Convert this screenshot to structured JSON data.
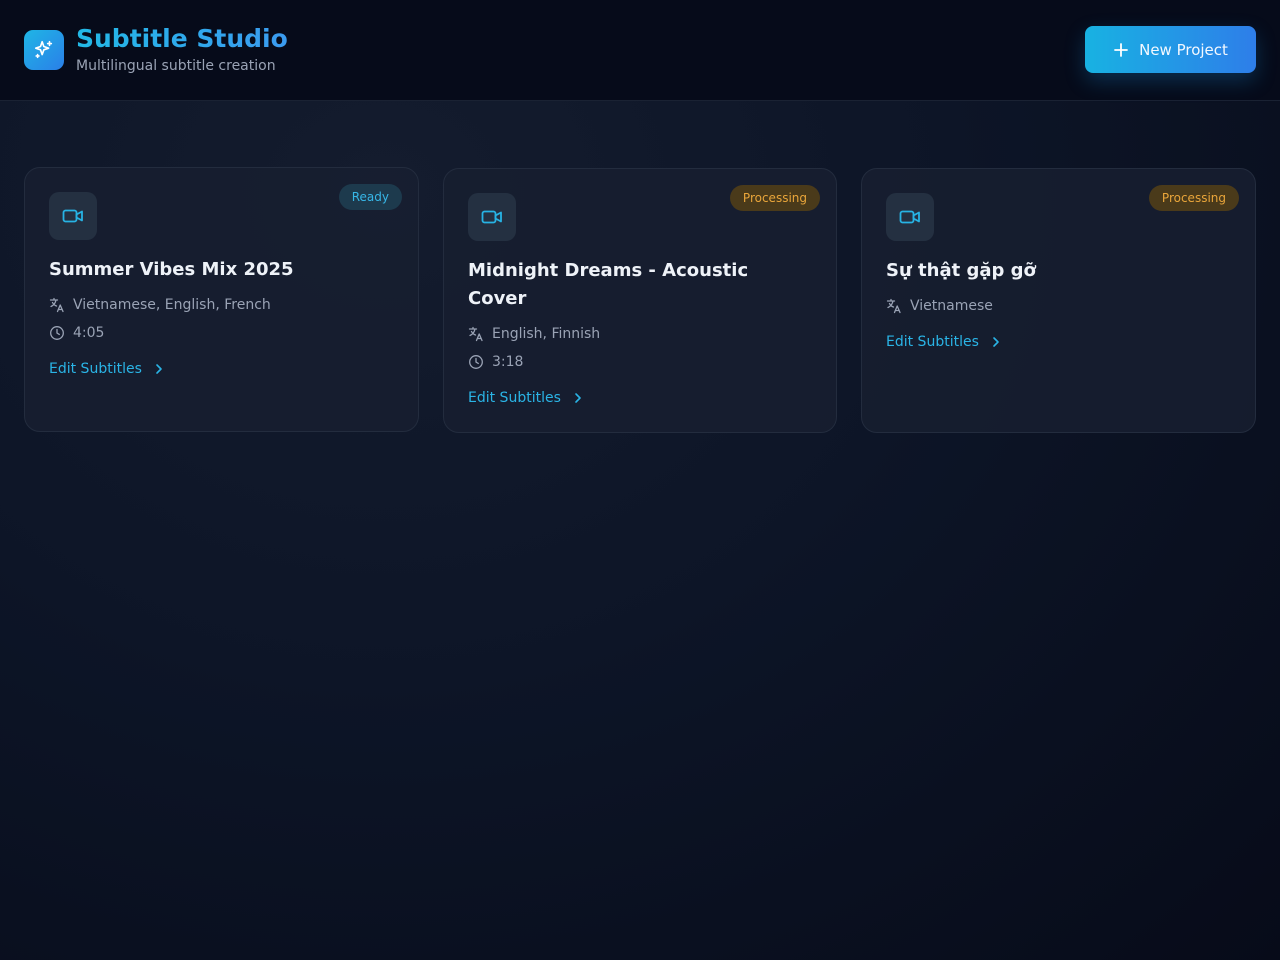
{
  "app": {
    "title": "Subtitle Studio",
    "subtitle": "Multilingual subtitle creation",
    "logo_icon": "sparkles-icon",
    "accent": "#22b9e6"
  },
  "toolbar": {
    "new_project_label": "New Project",
    "new_project_icon": "plus-icon"
  },
  "projects": [
    {
      "title": "Summer Vibes Mix 2025",
      "status": "Ready",
      "status_color": "#37b6e6",
      "languages": "Vietnamese, English, French",
      "duration": "4:05",
      "action_label": "Edit Subtitles"
    },
    {
      "title": "Midnight Dreams - Acoustic Cover",
      "status": "Processing",
      "status_color": "#e9a53a",
      "languages": "English, Finnish",
      "duration": "3:18",
      "action_label": "Edit Subtitles"
    },
    {
      "title": "Sự thật gặp gỡ",
      "status": "Processing",
      "status_color": "#e9a53a",
      "languages": "Vietnamese",
      "action_label": "Edit Subtitles"
    }
  ]
}
